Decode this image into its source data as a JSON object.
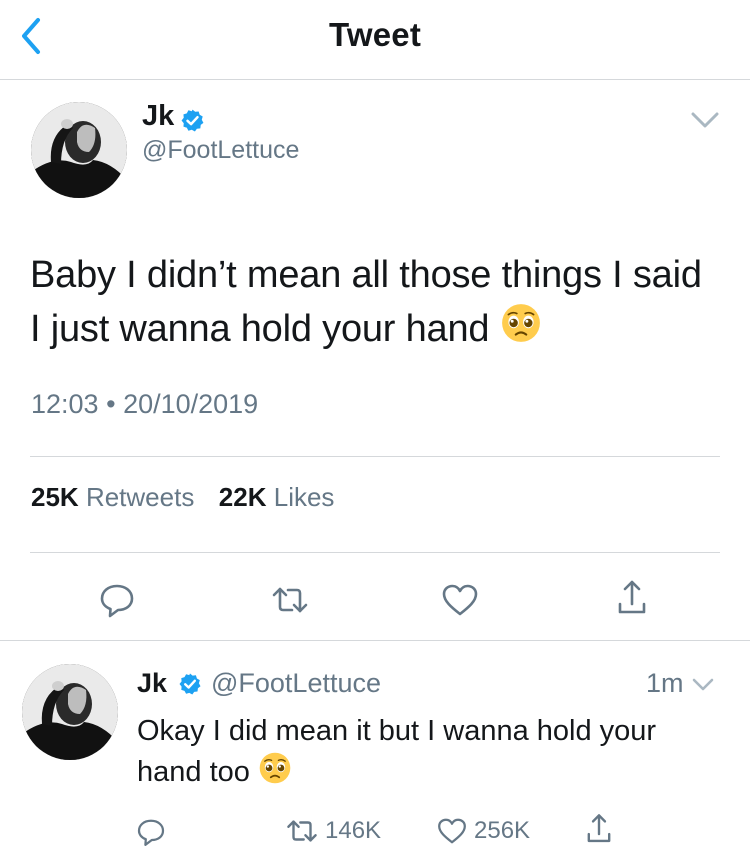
{
  "header": {
    "title": "Tweet"
  },
  "tweet": {
    "name": "Jk",
    "handle": "@FootLettuce",
    "text": "Baby I didn’t mean all those things I said I just wanna hold your hand",
    "emoji": "pleading-face",
    "time": "12:03",
    "date": "20/10/2019",
    "separator": "•",
    "retweets_count": "25K",
    "retweets_label": "Retweets",
    "likes_count": "22K",
    "likes_label": "Likes"
  },
  "reply": {
    "name": "Jk",
    "handle": "@FootLettuce",
    "time_ago": "1m",
    "text": "Okay I did mean it but I wanna hold your hand too",
    "emoji": "pleading-face",
    "retweets": "146K",
    "likes": "256K"
  },
  "icons": {
    "back": "chevron-left-icon",
    "verified": "verified-badge-icon",
    "more": "chevron-down-icon",
    "reply": "speech-bubble-icon",
    "retweet": "retweet-icon",
    "like": "heart-icon",
    "share": "share-icon"
  },
  "colors": {
    "accent": "#1da1f2",
    "text": "#14171a",
    "secondary": "#657786",
    "divider": "#d5d8db"
  }
}
